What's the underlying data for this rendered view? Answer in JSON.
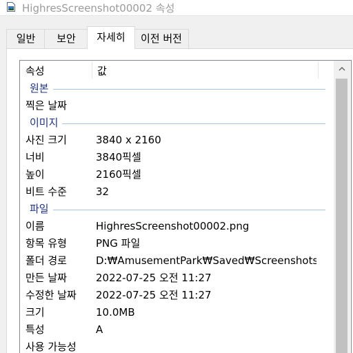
{
  "window": {
    "title": "HighresScreenshot00002 속성",
    "icon": "image-file-icon"
  },
  "tabs": [
    {
      "label": "일반",
      "active": false
    },
    {
      "label": "보안",
      "active": false
    },
    {
      "label": "자세히",
      "active": true
    },
    {
      "label": "이전 버전",
      "active": false
    }
  ],
  "list": {
    "header": {
      "property": "속성",
      "value": "값"
    },
    "groups": {
      "origin": {
        "title": "원본",
        "rows": [
          {
            "name": "찍은 날짜",
            "value": ""
          }
        ]
      },
      "image": {
        "title": "이미지",
        "rows": [
          {
            "name": "사진 크기",
            "value": "3840 x 2160"
          },
          {
            "name": "너비",
            "value": "3840픽셀"
          },
          {
            "name": "높이",
            "value": "2160픽셀"
          },
          {
            "name": "비트 수준",
            "value": "32"
          }
        ]
      },
      "file": {
        "title": "파일",
        "rows": [
          {
            "name": "이름",
            "value": "HighresScreenshot00002.png"
          },
          {
            "name": "항목 유형",
            "value": "PNG 파일"
          },
          {
            "name": "폴더 경로",
            "value": "D:₩AmusementPark₩Saved₩Screenshots₩Wi..."
          },
          {
            "name": "만든 날짜",
            "value": "2022-07-25 오전 11:27"
          },
          {
            "name": "수정한 날짜",
            "value": "2022-07-25 오전 11:27"
          },
          {
            "name": "크기",
            "value": "10.0MB"
          },
          {
            "name": "특성",
            "value": "A"
          },
          {
            "name": "사용 가능성",
            "value": ""
          }
        ]
      }
    }
  },
  "scrollbar": {
    "up_icon": "chevron-up-icon"
  }
}
